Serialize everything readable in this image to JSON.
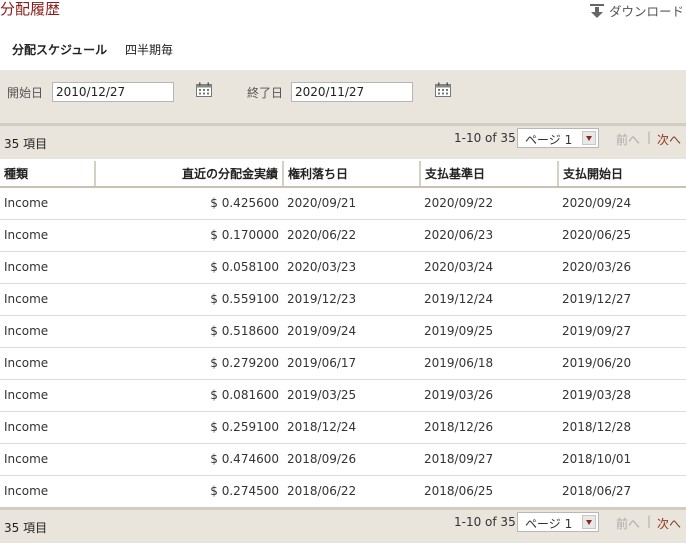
{
  "page": {
    "title": "分配履歴",
    "download_label": "ダウンロード"
  },
  "schedule": {
    "label": "分配スケジュール",
    "value": "四半期毎"
  },
  "dates": {
    "start_label": "開始日",
    "start_value": "2010/12/27",
    "end_label": "終了日",
    "end_value": "2020/11/27"
  },
  "pagination": {
    "count_label": "35 項目",
    "range": "1-10 of 35",
    "page_select": "ページ 1",
    "prev": "前へ",
    "separator": "|",
    "next": "次へ"
  },
  "table": {
    "headers": [
      "種類",
      "直近の分配金実績",
      "権利落ち日",
      "支払基準日",
      "支払開始日"
    ],
    "rows": [
      [
        "Income",
        "$ 0.425600",
        "2020/09/21",
        "2020/09/22",
        "2020/09/24"
      ],
      [
        "Income",
        "$ 0.170000",
        "2020/06/22",
        "2020/06/23",
        "2020/06/25"
      ],
      [
        "Income",
        "$ 0.058100",
        "2020/03/23",
        "2020/03/24",
        "2020/03/26"
      ],
      [
        "Income",
        "$ 0.559100",
        "2019/12/23",
        "2019/12/24",
        "2019/12/27"
      ],
      [
        "Income",
        "$ 0.518600",
        "2019/09/24",
        "2019/09/25",
        "2019/09/27"
      ],
      [
        "Income",
        "$ 0.279200",
        "2019/06/17",
        "2019/06/18",
        "2019/06/20"
      ],
      [
        "Income",
        "$ 0.081600",
        "2019/03/25",
        "2019/03/26",
        "2019/03/28"
      ],
      [
        "Income",
        "$ 0.259100",
        "2018/12/24",
        "2018/12/26",
        "2018/12/28"
      ],
      [
        "Income",
        "$ 0.474600",
        "2018/09/26",
        "2018/09/27",
        "2018/10/01"
      ],
      [
        "Income",
        "$ 0.274500",
        "2018/06/22",
        "2018/06/25",
        "2018/06/27"
      ]
    ]
  },
  "colors": {
    "title": "#8b1a1a",
    "filter_bar": "#e9e5dc",
    "next_link": "#8b3a1a"
  },
  "icons": {
    "download": "download-arrow-icon",
    "calendar": "calendar-icon",
    "dropdown": "chevron-down-icon"
  }
}
